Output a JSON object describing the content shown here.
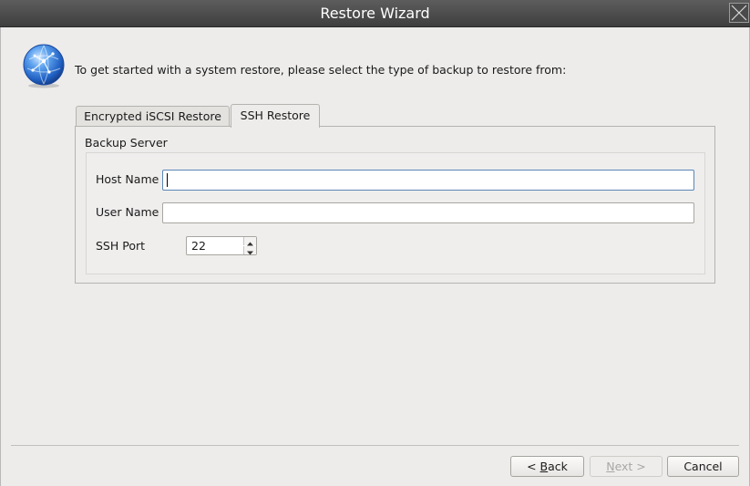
{
  "window": {
    "title": "Restore Wizard"
  },
  "intro": {
    "text": "To get started with a system restore, please select the type of backup to restore from:"
  },
  "tabs": [
    {
      "label": "Encrypted iSCSI Restore",
      "selected": false
    },
    {
      "label": "SSH Restore",
      "selected": true
    }
  ],
  "backup_server": {
    "group_title": "Backup Server",
    "host_name_label": "Host Name",
    "host_name_value": "",
    "user_name_label": "User Name",
    "user_name_value": "",
    "ssh_port_label": "SSH Port",
    "ssh_port_value": "22"
  },
  "buttons": {
    "back_prefix": "< ",
    "back_mnemonic": "B",
    "back_rest": "ack",
    "next_mnemonic": "N",
    "next_rest": "ext >",
    "cancel": "Cancel"
  },
  "icons": {
    "close": "close-icon",
    "globe": "globe-icon",
    "spin_up": "spin-up-arrow-icon",
    "spin_down": "spin-down-arrow-icon"
  },
  "colors": {
    "titlebar": "#4a4a4a",
    "window_bg": "#edeceb",
    "focus_border": "#5a86b6",
    "disabled_text": "#a8a7a4"
  }
}
